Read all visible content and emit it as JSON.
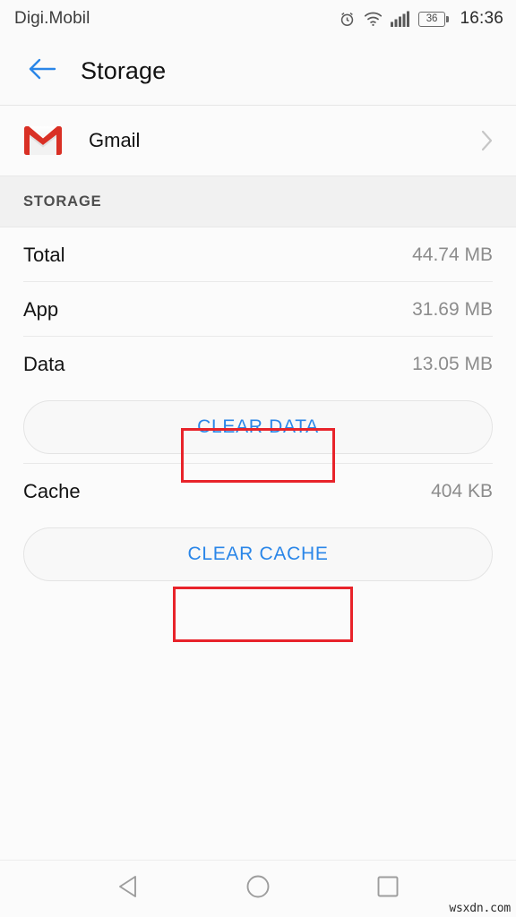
{
  "status_bar": {
    "carrier": "Digi.Mobil",
    "clock": "16:36",
    "battery_level": "36",
    "icons": [
      "alarm-icon",
      "wifi-icon",
      "signal-icon",
      "battery-icon"
    ]
  },
  "app_bar": {
    "back_icon": "arrow-left-icon",
    "title": "Storage",
    "accent_color": "#2a86e8"
  },
  "app_row": {
    "icon": "gmail-icon",
    "name": "Gmail",
    "chevron_icon": "chevron-right-icon"
  },
  "section": {
    "header": "STORAGE"
  },
  "stats": [
    {
      "label": "Total",
      "value": "44.74 MB"
    },
    {
      "label": "App",
      "value": "31.69 MB"
    },
    {
      "label": "Data",
      "value": "13.05 MB"
    }
  ],
  "clear_data_button": {
    "label": "CLEAR DATA"
  },
  "cache": {
    "label": "Cache",
    "value": "404 KB"
  },
  "clear_cache_button": {
    "label": "CLEAR CACHE"
  },
  "annotations": {
    "color": "#e8232a",
    "boxes": [
      "clear-data-highlight",
      "clear-cache-highlight"
    ]
  },
  "nav_bar": {
    "back": "back-triangle-icon",
    "home": "home-circle-icon",
    "recents": "recents-square-icon"
  },
  "watermark": {
    "text": "wsxdn.com"
  }
}
